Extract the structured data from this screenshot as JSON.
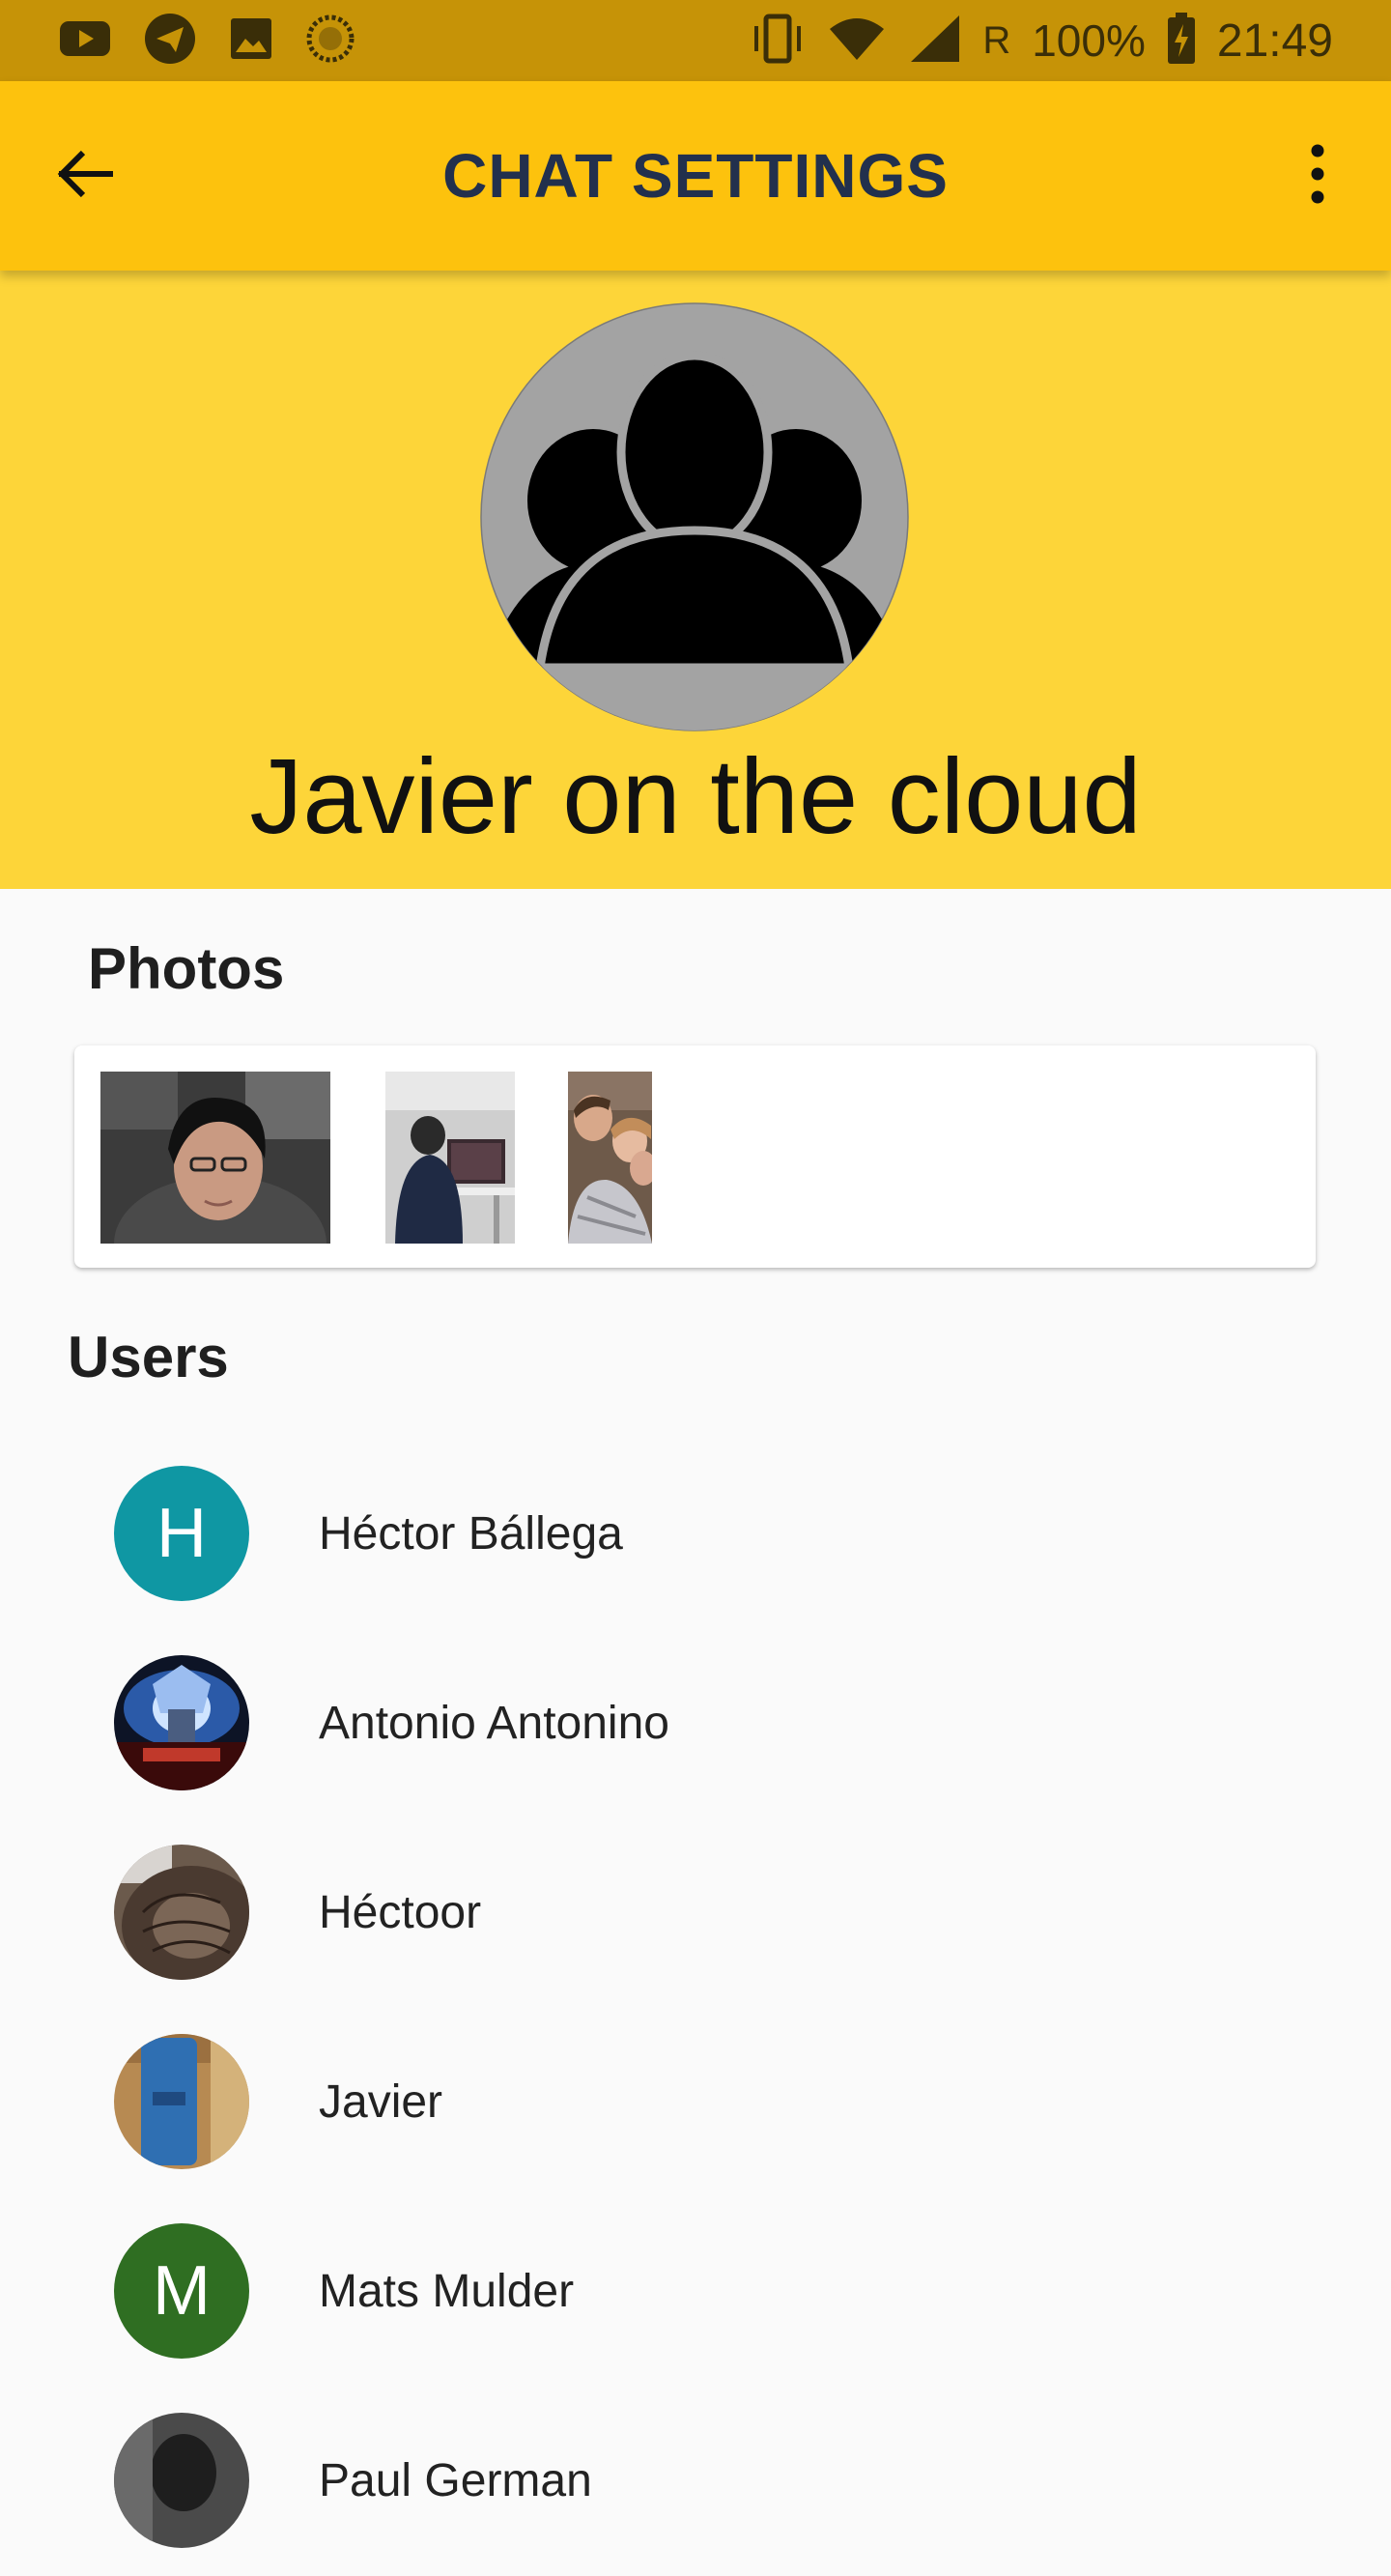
{
  "status_bar": {
    "network": "R",
    "battery": "100%",
    "time": "21:49",
    "left_icons": [
      "youtube-icon",
      "telegram-icon",
      "gallery-icon",
      "sync-icon"
    ],
    "right_icons": [
      "vibrate-icon",
      "wifi-icon",
      "signal-icon",
      "battery-charging-icon"
    ]
  },
  "app_bar": {
    "title": "CHAT SETTINGS",
    "back_icon": "arrow-back-icon",
    "menu_icon": "more-vert-icon",
    "background": "#fdc20d"
  },
  "group": {
    "name": "Javier on the cloud",
    "avatar_icon": "group-icon",
    "background": "#fdd539"
  },
  "photos": {
    "title": "Photos",
    "items": [
      "photo-selfie",
      "photo-office",
      "photo-group"
    ]
  },
  "users": {
    "title": "Users",
    "items": [
      {
        "name": "Héctor Bállega",
        "avatar_letter": "H",
        "avatar_color": "#0f97a3"
      },
      {
        "name": "Antonio Antonino",
        "avatar_letter": "",
        "avatar_color": ""
      },
      {
        "name": "Héctoor",
        "avatar_letter": "",
        "avatar_color": ""
      },
      {
        "name": "Javier",
        "avatar_letter": "",
        "avatar_color": ""
      },
      {
        "name": "Mats Mulder",
        "avatar_letter": "M",
        "avatar_color": "#2f6e22"
      },
      {
        "name": "Paul German",
        "avatar_letter": "",
        "avatar_color": ""
      }
    ]
  }
}
